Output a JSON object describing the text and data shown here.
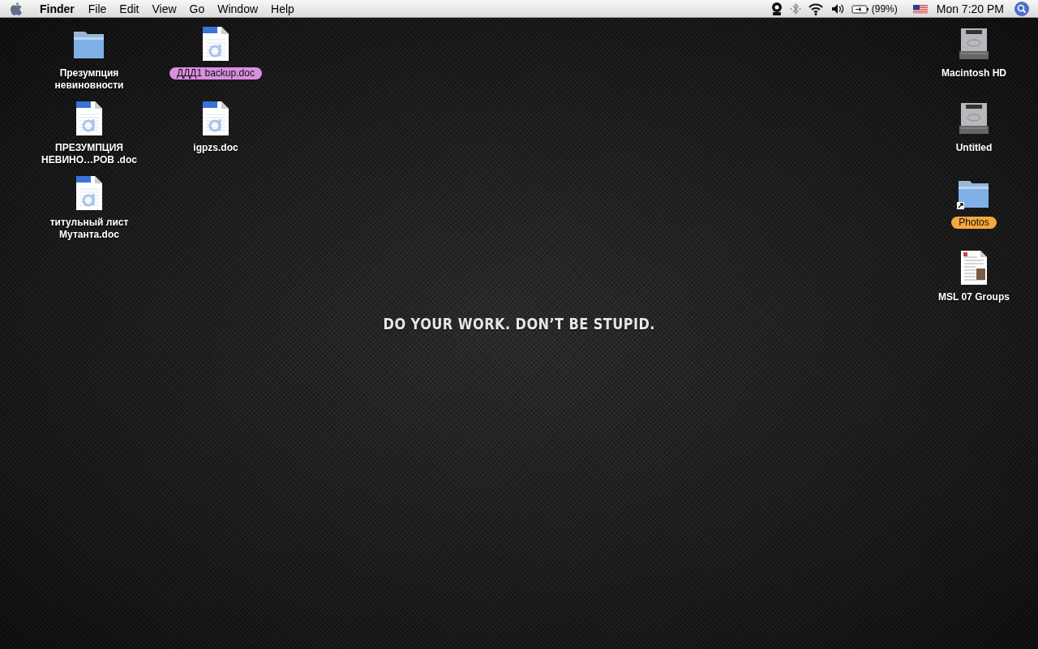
{
  "menu_bar": {
    "app": "Finder",
    "menus": [
      "File",
      "Edit",
      "View",
      "Go",
      "Window",
      "Help"
    ],
    "battery": "(99%)",
    "clock": "Mon 7:20 PM"
  },
  "desktop": {
    "left_columns": [
      [
        {
          "kind": "folder",
          "name": "Презумпция невиновности"
        },
        {
          "kind": "doc",
          "name": "ПРЕЗУМПЦИЯ НЕВИНО…РОВ .doc"
        },
        {
          "kind": "doc",
          "name": "титульный лист Мутанта.doc"
        }
      ],
      [
        {
          "kind": "doc",
          "name": "ДДД1 backup.doc",
          "color": "#d98fe0"
        },
        {
          "kind": "doc",
          "name": "igpzs.doc"
        }
      ]
    ],
    "right_column": [
      {
        "kind": "disk",
        "name": "Macintosh HD"
      },
      {
        "kind": "disk",
        "name": "Untitled"
      },
      {
        "kind": "folder-alias",
        "name": "Photos",
        "color": "#f7a83c"
      },
      {
        "kind": "page",
        "name": "MSL 07 Groups"
      }
    ]
  },
  "wallpaper": {
    "text": "DO YOUR WORK. DON’T BE STUPID."
  }
}
